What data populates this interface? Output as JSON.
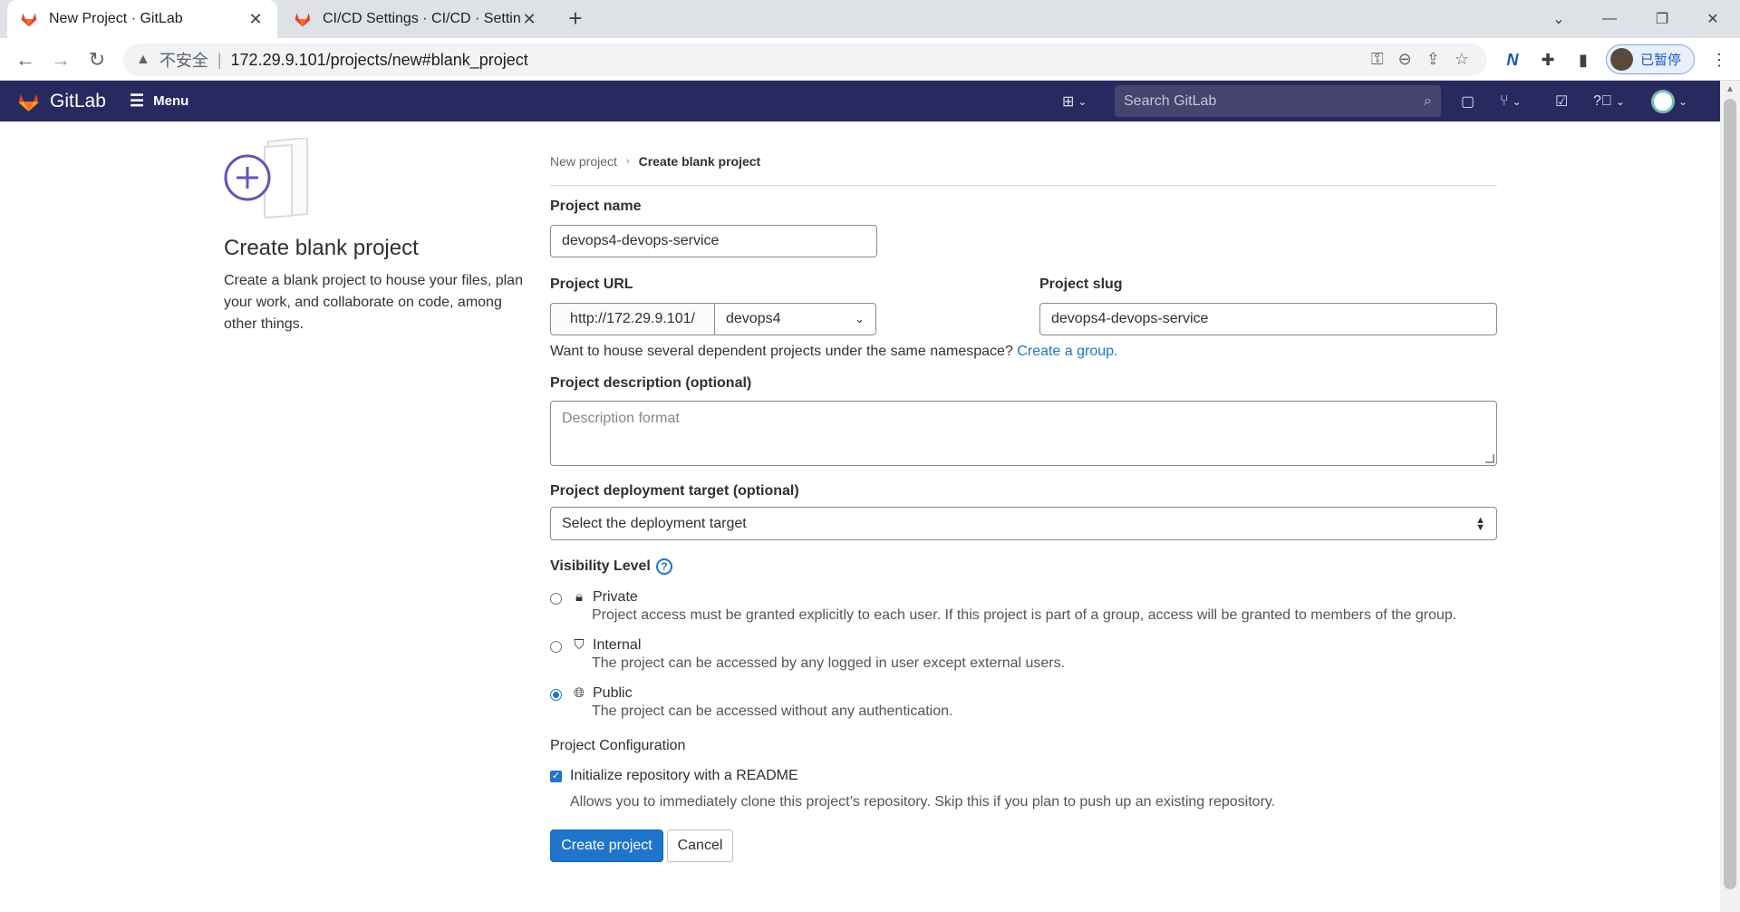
{
  "browser": {
    "tabs": [
      {
        "title": "New Project · GitLab",
        "active": true
      },
      {
        "title": "CI/CD Settings · CI/CD · Setting",
        "active": false
      }
    ],
    "address": {
      "security_label": "不安全",
      "url": "172.29.9.101/projects/new#blank_project"
    },
    "profile_label": "已暂停"
  },
  "header": {
    "brand": "GitLab",
    "menu_label": "Menu",
    "search_placeholder": "Search GitLab"
  },
  "left": {
    "title": "Create blank project",
    "description": "Create a blank project to house your files, plan your work, and collaborate on code, among other things."
  },
  "breadcrumb": {
    "parent": "New project",
    "current": "Create blank project"
  },
  "form": {
    "project_name_label": "Project name",
    "project_name_value": "devops4-devops-service",
    "project_url_label": "Project URL",
    "url_prefix": "http://172.29.9.101/",
    "namespace": "devops4",
    "slug_label": "Project slug",
    "slug_value": "devops4-devops-service",
    "namespace_help": "Want to house several dependent projects under the same namespace?",
    "create_group_link": "Create a group.",
    "description_label": "Project description (optional)",
    "description_placeholder": "Description format",
    "deploy_label": "Project deployment target (optional)",
    "deploy_value": "Select the deployment target",
    "visibility_label": "Visibility Level",
    "visibility": [
      {
        "title": "Private",
        "desc": "Project access must be granted explicitly to each user. If this project is part of a group, access will be granted to members of the group.",
        "icon": "lock-icon",
        "checked": false
      },
      {
        "title": "Internal",
        "desc": "The project can be accessed by any logged in user except external users.",
        "icon": "shield-icon",
        "checked": false
      },
      {
        "title": "Public",
        "desc": "The project can be accessed without any authentication.",
        "icon": "globe-icon",
        "checked": true
      }
    ],
    "config_label": "Project Configuration",
    "readme_label": "Initialize repository with a README",
    "readme_desc": "Allows you to immediately clone this project’s repository. Skip this if you plan to push up an existing repository.",
    "readme_checked": true,
    "create_button": "Create project",
    "cancel_button": "Cancel"
  },
  "colors": {
    "header_bg": "#292961",
    "primary": "#1f75cb",
    "illustration": "#6b4fbb"
  }
}
